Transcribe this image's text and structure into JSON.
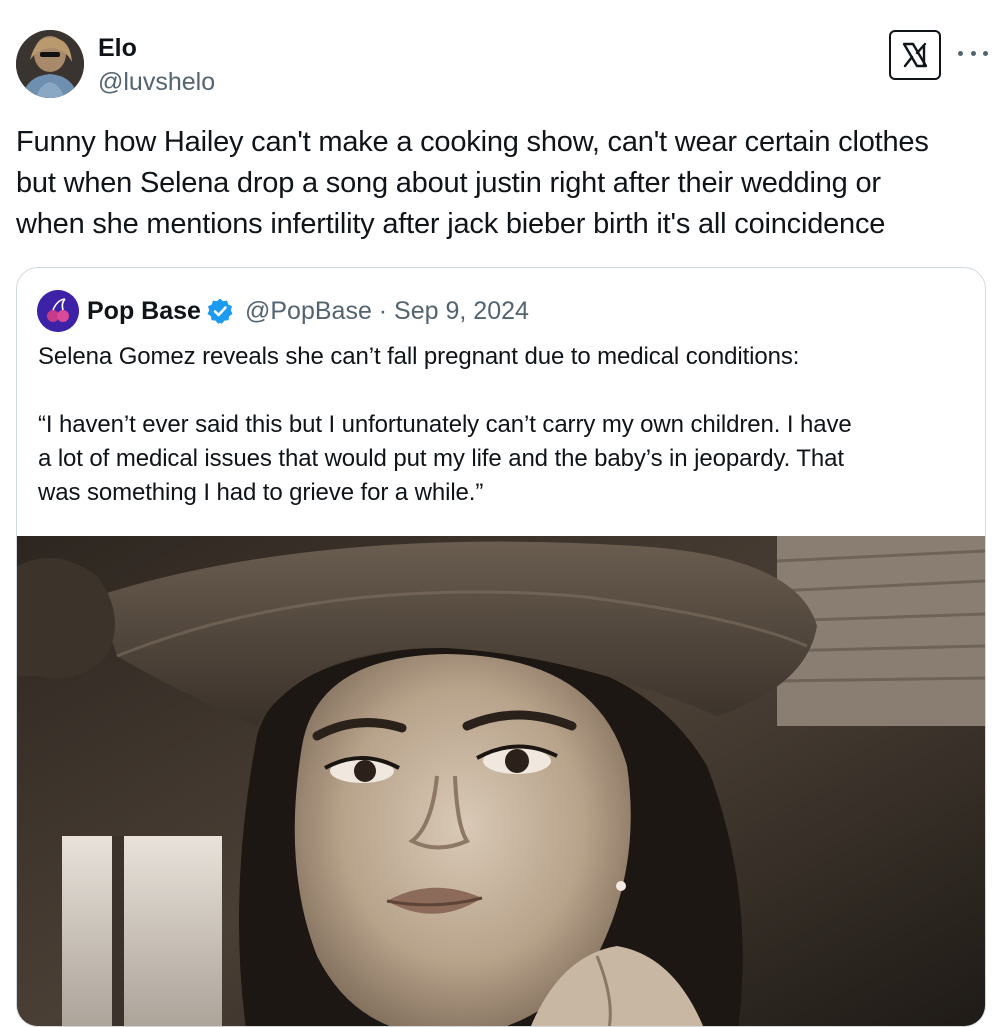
{
  "tweet": {
    "author": {
      "name": "Elo",
      "handle": "@luvshelo",
      "avatar_icon": "profile-photo"
    },
    "text_lines": [
      "Funny how Hailey can't make a cooking show, can't wear certain clothes",
      "but when Selena drop a song about justin right after their wedding or",
      "when she mentions infertility after jack bieber birth it's all coincidence"
    ],
    "brand_icon": "x-logo-icon",
    "menu_icon": "more-options-icon"
  },
  "quote": {
    "author": {
      "name": "Pop Base",
      "verified": true,
      "handle_date": "@PopBase · Sep 9, 2024",
      "verified_color": "#1d9bf0"
    },
    "text_lines_1": [
      "Selena Gomez reveals she can’t fall pregnant due to medical conditions:"
    ],
    "text_lines_2": [
      "“I haven’t ever said this but I unfortunately can’t carry my own children. I have",
      "a lot of medical issues that would put my life and the baby’s in jeopardy. That",
      "was something I had to grieve for a while.”"
    ],
    "media": {
      "kind": "sepia-portrait-photo"
    }
  },
  "colors": {
    "text_primary": "#0f1419",
    "text_secondary": "#536471",
    "border": "#cfd9de"
  }
}
